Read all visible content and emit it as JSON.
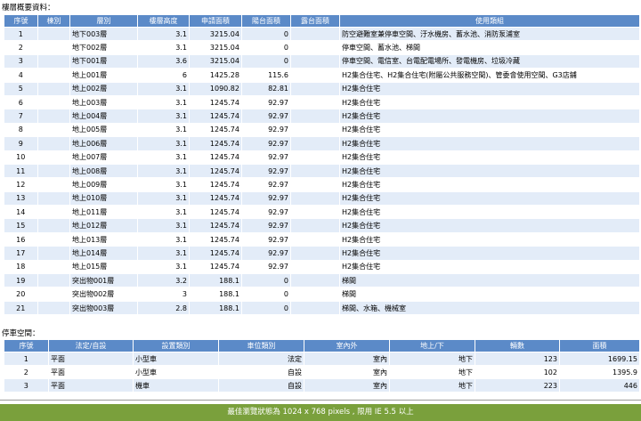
{
  "floors": {
    "title": "樓層概要資料：",
    "headers": [
      "序號",
      "棟別",
      "層別",
      "樓層高度",
      "申請面積",
      "陽台面積",
      "露台面積",
      "使用類組"
    ],
    "rows": [
      [
        "1",
        "",
        "地下003層",
        "3.1",
        "3215.04",
        "0",
        "",
        "防空避難室兼停車空間、汙水機房、蓄水池、消防泵浦室"
      ],
      [
        "2",
        "",
        "地下002層",
        "3.1",
        "3215.04",
        "0",
        "",
        "停車空間、蓄水池、梯間"
      ],
      [
        "3",
        "",
        "地下001層",
        "3.6",
        "3215.04",
        "0",
        "",
        "停車空間、電信室、台電配電場所、發電機房、垃圾冷藏"
      ],
      [
        "4",
        "",
        "地上001層",
        "6",
        "1425.28",
        "115.6",
        "",
        "H2集合住宅、H2集合住宅(附屬公共服務空間)、管委會使用空間、G3店鋪"
      ],
      [
        "5",
        "",
        "地上002層",
        "3.1",
        "1090.82",
        "82.81",
        "",
        "H2集合住宅"
      ],
      [
        "6",
        "",
        "地上003層",
        "3.1",
        "1245.74",
        "92.97",
        "",
        "H2集合住宅"
      ],
      [
        "7",
        "",
        "地上004層",
        "3.1",
        "1245.74",
        "92.97",
        "",
        "H2集合住宅"
      ],
      [
        "8",
        "",
        "地上005層",
        "3.1",
        "1245.74",
        "92.97",
        "",
        "H2集合住宅"
      ],
      [
        "9",
        "",
        "地上006層",
        "3.1",
        "1245.74",
        "92.97",
        "",
        "H2集合住宅"
      ],
      [
        "10",
        "",
        "地上007層",
        "3.1",
        "1245.74",
        "92.97",
        "",
        "H2集合住宅"
      ],
      [
        "11",
        "",
        "地上008層",
        "3.1",
        "1245.74",
        "92.97",
        "",
        "H2集合住宅"
      ],
      [
        "12",
        "",
        "地上009層",
        "3.1",
        "1245.74",
        "92.97",
        "",
        "H2集合住宅"
      ],
      [
        "13",
        "",
        "地上010層",
        "3.1",
        "1245.74",
        "92.97",
        "",
        "H2集合住宅"
      ],
      [
        "14",
        "",
        "地上011層",
        "3.1",
        "1245.74",
        "92.97",
        "",
        "H2集合住宅"
      ],
      [
        "15",
        "",
        "地上012層",
        "3.1",
        "1245.74",
        "92.97",
        "",
        "H2集合住宅"
      ],
      [
        "16",
        "",
        "地上013層",
        "3.1",
        "1245.74",
        "92.97",
        "",
        "H2集合住宅"
      ],
      [
        "17",
        "",
        "地上014層",
        "3.1",
        "1245.74",
        "92.97",
        "",
        "H2集合住宅"
      ],
      [
        "18",
        "",
        "地上015層",
        "3.1",
        "1245.74",
        "92.97",
        "",
        "H2集合住宅"
      ],
      [
        "19",
        "",
        "突出物001層",
        "3.2",
        "188.1",
        "0",
        "",
        "梯間"
      ],
      [
        "20",
        "",
        "突出物002層",
        "3",
        "188.1",
        "0",
        "",
        "梯間"
      ],
      [
        "21",
        "",
        "突出物003層",
        "2.8",
        "188.1",
        "0",
        "",
        "梯間、水箱、機械室"
      ]
    ]
  },
  "parking": {
    "title": "停車空間：",
    "headers": [
      "序號",
      "法定/自設",
      "設置類別",
      "車位類別",
      "室內外",
      "地上/下",
      "輛數",
      "面積"
    ],
    "rows": [
      [
        "1",
        "平面",
        "小型車",
        "法定",
        "室內",
        "地下",
        "123",
        "1699.15"
      ],
      [
        "2",
        "平面",
        "小型車",
        "自設",
        "室內",
        "地下",
        "102",
        "1395.9"
      ],
      [
        "3",
        "平面",
        "機車",
        "自設",
        "室內",
        "地下",
        "223",
        "446"
      ]
    ]
  },
  "footer": {
    "text": "最佳瀏覽狀態為 1024 x 768 pixels , 限用 IE 5.5 以上"
  },
  "colors": {
    "header_bg": "#5b8ac8",
    "row_alt": "#e3ecf8",
    "footer_bg": "#7aa03c"
  }
}
